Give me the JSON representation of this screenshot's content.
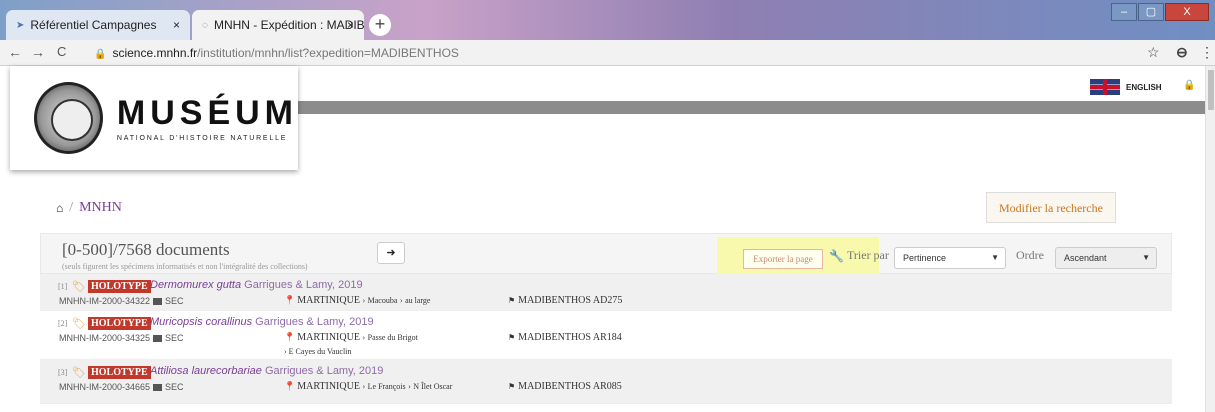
{
  "browser": {
    "tabs": [
      {
        "icon": "campaign-icon",
        "title": "Référentiel Campagnes",
        "close": "×"
      },
      {
        "icon": "loading-icon",
        "title": "MNHN - Expédition : MADIBENTH",
        "close": "×"
      }
    ],
    "new_tab": "+",
    "window_controls": {
      "minimize": "–",
      "maximize": "▢",
      "close": "X"
    },
    "nav": {
      "back": "←",
      "forward": "→",
      "reload": "C"
    },
    "url_domain": "science.mnhn.fr",
    "url_path": "/institution/mnhn/list?expedition=MADIBENTHOS",
    "right_icons": {
      "star": "☆",
      "account": "⊖",
      "menu": "⋮"
    }
  },
  "header": {
    "logo_title": "MUSÉUM",
    "logo_subtitle": "NATIONAL D'HISTOIRE NATURELLE",
    "language": "ENGLISH",
    "lock": "🔒"
  },
  "breadcrumb": {
    "home": "⌂",
    "sep": "/",
    "current": "MNHN"
  },
  "modify_button": "Modifier la recherche",
  "results": {
    "count": "[0-500]/7568 documents",
    "note": "(seuls figurent les spécimens informatisés et non l'intégralité des collections)",
    "next": "➜",
    "export": "Exporter la page",
    "sort_label": "Trier par",
    "sort_value": "Pertinence",
    "order_label": "Ordre",
    "order_value": "Ascendant"
  },
  "rows": [
    {
      "index": "[1]",
      "badge": "HOLOTYPE",
      "species": "Dermomurex gutta",
      "author": "Garrigues & Lamy, 2019",
      "catalog": "MNHN-IM-2000-34322",
      "prep": "SEC",
      "country": "MARTINIQUE",
      "loc1": "Macouba",
      "loc2": "au large",
      "loc3": "",
      "station": "MADIBENTHOS AD275"
    },
    {
      "index": "[2]",
      "badge": "HOLOTYPE",
      "species": "Muricopsis corallinus",
      "author": "Garrigues & Lamy, 2019",
      "catalog": "MNHN-IM-2000-34325",
      "prep": "SEC",
      "country": "MARTINIQUE",
      "loc1": "Passe du Brigot",
      "loc2": "",
      "loc3": "E Cayes du Vauclin",
      "station": "MADIBENTHOS AR184"
    },
    {
      "index": "[3]",
      "badge": "HOLOTYPE",
      "species": "Attiliosa laurecorbariae",
      "author": "Garrigues & Lamy, 2019",
      "catalog": "MNHN-IM-2000-34665",
      "prep": "SEC",
      "country": "MARTINIQUE",
      "loc1": "Le François",
      "loc2": "N Îlet Oscar",
      "loc3": "",
      "station": "MADIBENTHOS AR085"
    }
  ]
}
